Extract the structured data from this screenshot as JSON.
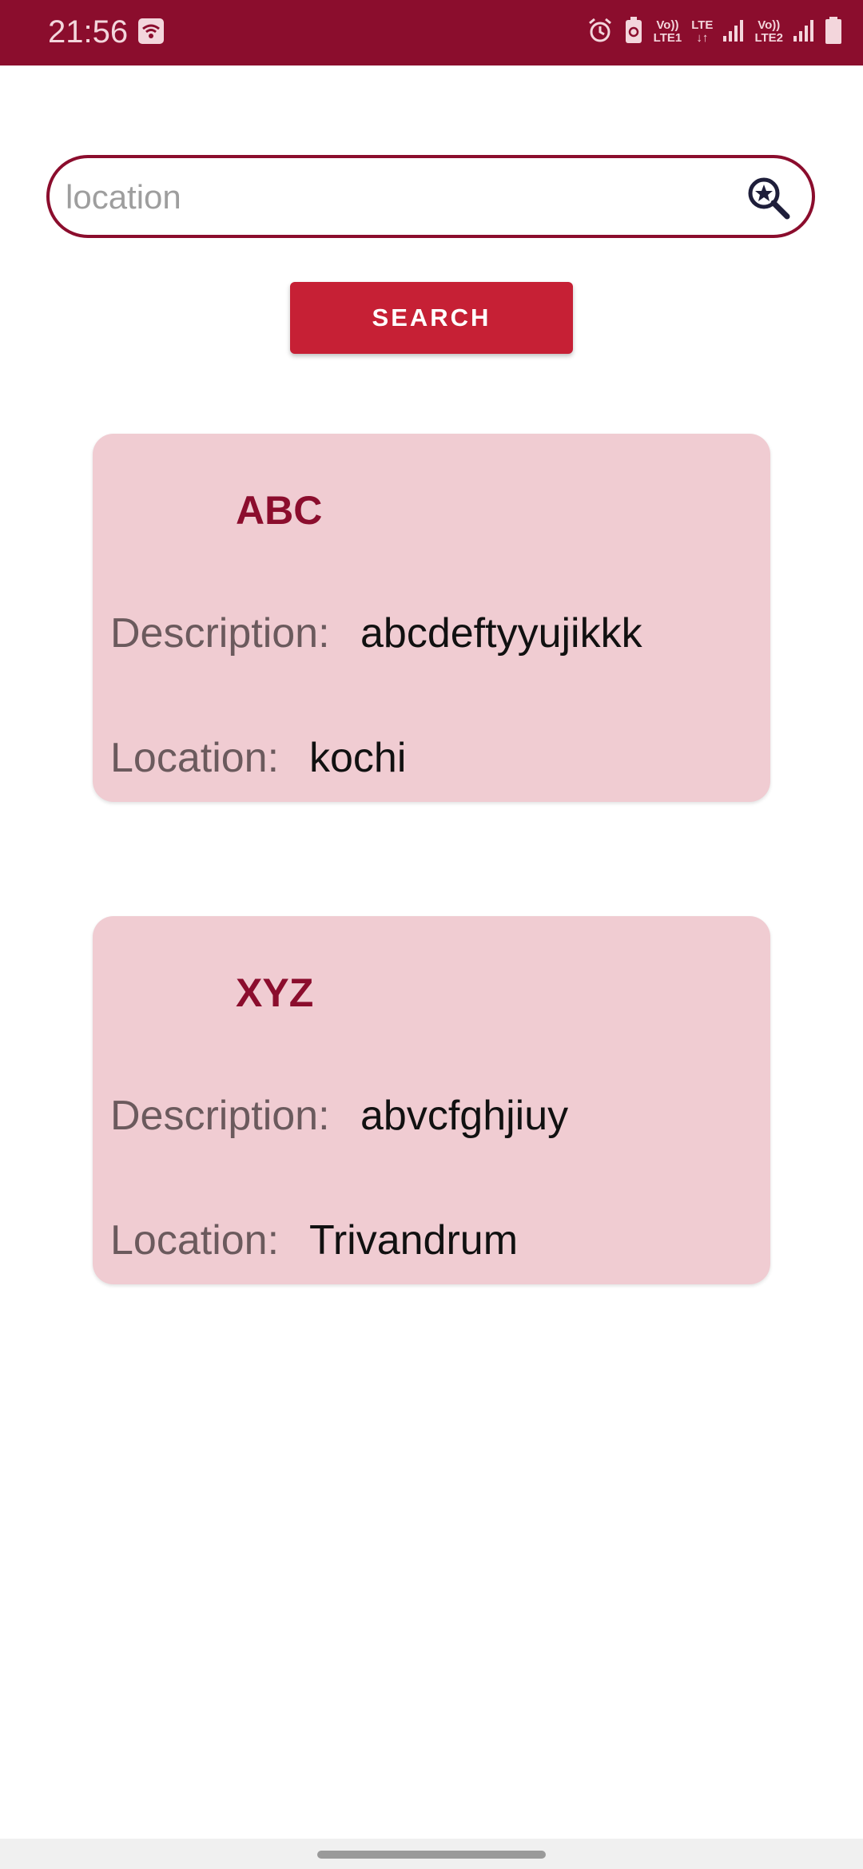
{
  "status_bar": {
    "time": "21:56",
    "sim1_top": "Vo))",
    "sim1_bottom": "LTE1",
    "lte_top": "LTE",
    "lte_bottom": "↓↑",
    "sim2_top": "Vo))",
    "sim2_bottom": "LTE2",
    "icons": [
      "wifi-icon",
      "alarm-icon",
      "battery-saver-icon",
      "signal-icon",
      "signal-icon",
      "battery-icon"
    ]
  },
  "search": {
    "placeholder": "location",
    "value": "",
    "icon": "search-star-icon",
    "button_label": "SEARCH"
  },
  "results": [
    {
      "title": "ABC",
      "description_label": "Description:",
      "description": "abcdeftyyujikkk",
      "location_label": "Location:",
      "location": "kochi"
    },
    {
      "title": "XYZ",
      "description_label": "Description:",
      "description": "abvcfghjiuy",
      "location_label": "Location:",
      "location": "Trivandrum"
    }
  ],
  "colors": {
    "primary": "#8b0d2d",
    "button": "#c62035",
    "card_background": "#f0ccd2"
  }
}
